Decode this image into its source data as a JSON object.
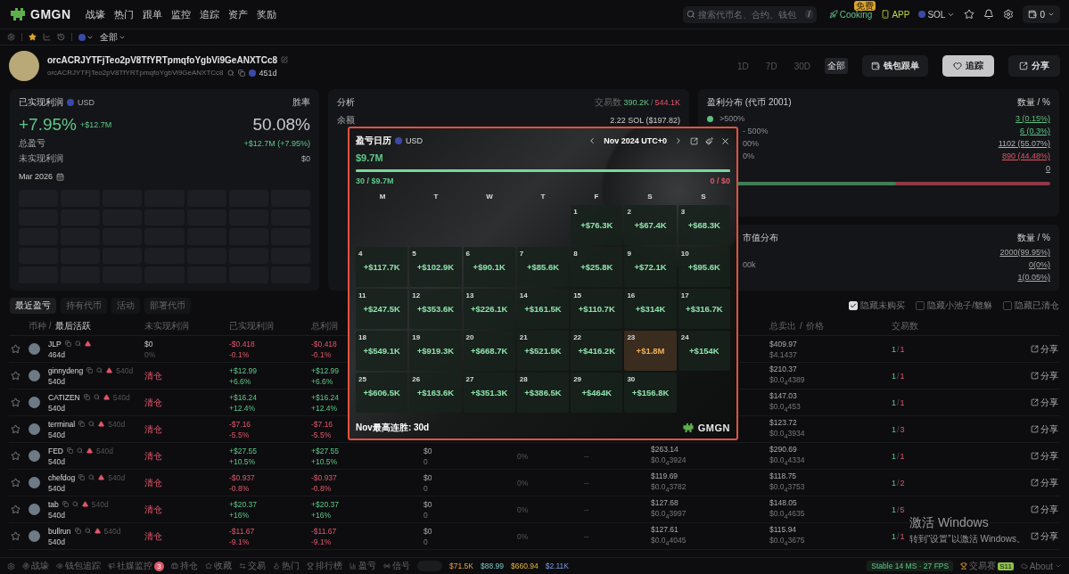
{
  "nav": {
    "logo": "GMGN",
    "items": [
      "战壕",
      "热门",
      "跟单",
      "监控",
      "追踪",
      "资产",
      "奖励"
    ],
    "search": {
      "placeholder": "搜索代币名、合约、钱包",
      "shortcut": "/"
    },
    "cooking": {
      "label": "Cooking",
      "badge": "免费"
    },
    "app": "APP",
    "chain": "SOL",
    "wallet_count": "0"
  },
  "subbar": {
    "filter": "全部"
  },
  "profile": {
    "name": "orcACRJYTFjTeo2pV8TfYRTpmqfoYgbVi9GeANXTCc8",
    "address": "orcACRJYTFjTeo2pV8TfYRTpmqfoYgbVi9GeANXTCc8",
    "age": "451d",
    "periods": [
      {
        "label": "1D",
        "selected": false
      },
      {
        "label": "7D",
        "selected": false
      },
      {
        "label": "30D",
        "selected": false
      },
      {
        "label": "全部",
        "selected": true
      }
    ],
    "buttons": [
      {
        "kind": "copytrade",
        "label": "钱包跟单"
      },
      {
        "kind": "follow",
        "label": "追踪"
      },
      {
        "kind": "share",
        "label": "分享"
      }
    ]
  },
  "pnl_panel": {
    "title": "已实现利润",
    "currency": "USD",
    "winrate_label": "胜率",
    "pct": "+7.95%",
    "amount": "+$12.7M",
    "winrate": "50.08%",
    "rows": [
      {
        "label": "总盈亏",
        "value": "+$12.7M (+7.95%)",
        "kind": "gain"
      },
      {
        "label": "未实现利润",
        "value": "$0",
        "kind": "neutral"
      }
    ],
    "month": "Mar 2026"
  },
  "analysis_panel": {
    "title": "分析",
    "trades_label": "交易数",
    "trades_buy": "390.2K",
    "trades_sep": "/",
    "trades_sell": "544.1K",
    "rows": [
      {
        "label": "余额",
        "value": "2.22 SOL ($197.82)"
      }
    ]
  },
  "profit_dist": {
    "title": "盈利分布 (代币 2001)",
    "header": "数量 / %",
    "rows": [
      {
        "label": ">500%",
        "value": "3 (0.15%)",
        "color": "#5fbf7f"
      },
      {
        "label": "- 500%",
        "value": "6 (0.3%)",
        "kind": "gain"
      },
      {
        "label": "00%",
        "value": "1102 (55.07%)",
        "kind": "neutral"
      },
      {
        "label": "0%",
        "value": "890 (44.48%)",
        "kind": "loss"
      },
      {
        "value": "0",
        "kind": "neutral"
      }
    ],
    "level": 0.55
  },
  "mcap_dist": {
    "title": "市值分布",
    "header": "数量 / %",
    "rows": [
      {
        "value": "2000(99.95%)"
      },
      {
        "label": "00k",
        "value": "0(0%)"
      },
      {
        "value": "1(0.05%)"
      }
    ]
  },
  "tabs": [
    {
      "label": "最近盈亏",
      "selected": true
    },
    {
      "label": "持有代币",
      "selected": false
    },
    {
      "label": "活动",
      "selected": false
    },
    {
      "label": "部署代币",
      "selected": false
    }
  ],
  "filters": [
    {
      "label": "隐藏未购买",
      "checked": true
    },
    {
      "label": "隐藏小池子/貔貅",
      "checked": false
    },
    {
      "label": "隐藏已清仓",
      "checked": false
    }
  ],
  "table": {
    "columns": {
      "token_prefix": "币种 /",
      "token": "最后活跃",
      "unrealized": "未实现利润",
      "realized": "已实现利润",
      "total": "总利润",
      "sold": "总卖出",
      "sep": "/",
      "price": "价格",
      "trades": "交易数"
    },
    "rows": [
      {
        "token": "JLP",
        "age": "464d",
        "unrealized": {
          "kind": "amount",
          "value": "$0",
          "pct": "0%"
        },
        "realized": {
          "value": "-$0.418",
          "pct": "-0.1%",
          "kind": "loss"
        },
        "total": {
          "value": "-$0.418",
          "pct": "-0.1%",
          "kind": "loss"
        },
        "sold": [
          "$409.97",
          "$4.1437"
        ],
        "wins": "1",
        "sep": "/",
        "trades": "1",
        "share": "分享"
      },
      {
        "token": "ginnydeng",
        "tag": "540d",
        "age": "540d",
        "unrealized": {
          "kind": "closed",
          "label": "清仓"
        },
        "realized": {
          "value": "+$12.99",
          "pct": "+6.6%",
          "kind": "gain"
        },
        "total": {
          "value": "+$12.99",
          "pct": "+6.6%",
          "kind": "gain"
        },
        "sold": [
          "$210.37",
          "$0.0$_{4}$4389"
        ],
        "wins": "1",
        "sep": "/",
        "trades": "1",
        "share": "分享"
      },
      {
        "token": "CATIZEN",
        "tag": "540d",
        "age": "540d",
        "unrealized": {
          "kind": "closed",
          "label": "清仓"
        },
        "realized": {
          "value": "+$16.24",
          "pct": "+12.4%",
          "kind": "gain"
        },
        "total": {
          "value": "+$16.24",
          "pct": "+12.4%",
          "kind": "gain"
        },
        "sold": [
          "$147.03",
          "$0.0$_{4}$453"
        ],
        "wins": "1",
        "sep": "/",
        "trades": "1",
        "share": "分享"
      },
      {
        "token": "terminal",
        "tag": "540d",
        "age": "540d",
        "unrealized": {
          "kind": "closed",
          "label": "清仓"
        },
        "realized": {
          "value": "-$7.16",
          "pct": "-5.5%",
          "kind": "loss"
        },
        "total": {
          "value": "-$7.16",
          "pct": "-5.5%",
          "kind": "loss"
        },
        "sold": [
          "$123.72",
          "$0.0$_{4}$3934"
        ],
        "wins": "1",
        "sep": "/",
        "trades": "3",
        "share": "分享"
      },
      {
        "token": "FED",
        "tag": "540d",
        "age": "540d",
        "unrealized": {
          "kind": "closed",
          "label": "清仓"
        },
        "realized": {
          "value": "+$27.55",
          "pct": "+10.5%",
          "kind": "gain"
        },
        "total": {
          "value": "+$27.55",
          "pct": "+10.5%",
          "kind": "gain"
        },
        "col5": [
          "$0",
          "0"
        ],
        "col6": "0%",
        "col7": "--",
        "bought": [
          "$263.14",
          "$0.0$_{4}$3924"
        ],
        "sold": [
          "$290.69",
          "$0.0$_{4}$4334"
        ],
        "wins": "1",
        "sep": "/",
        "trades": "1",
        "share": "分享"
      },
      {
        "token": "chefdog",
        "tag": "540d",
        "age": "540d",
        "unrealized": {
          "kind": "closed",
          "label": "清仓"
        },
        "realized": {
          "value": "-$0.937",
          "pct": "-0.8%",
          "kind": "loss"
        },
        "total": {
          "value": "-$0.937",
          "pct": "-0.8%",
          "kind": "loss"
        },
        "col5": [
          "$0",
          "0"
        ],
        "col6": "0%",
        "col7": "--",
        "bought": [
          "$119.69",
          "$0.0$_{4}$3782"
        ],
        "sold": [
          "$118.75",
          "$0.0$_{4}$3753"
        ],
        "wins": "1",
        "sep": "/",
        "trades": "2",
        "share": "分享"
      },
      {
        "token": "tab",
        "tag": "540d",
        "age": "540d",
        "unrealized": {
          "kind": "closed",
          "label": "清仓"
        },
        "realized": {
          "value": "+$20.37",
          "pct": "+16%",
          "kind": "gain"
        },
        "total": {
          "value": "+$20.37",
          "pct": "+16%",
          "kind": "gain"
        },
        "col5": [
          "$0",
          "0"
        ],
        "col6": "0%",
        "col7": "--",
        "bought": [
          "$127.68",
          "$0.0$_{4}$3997"
        ],
        "sold": [
          "$148.05",
          "$0.0$_{4}$4635"
        ],
        "wins": "1",
        "sep": "/",
        "trades": "5",
        "share": "分享"
      },
      {
        "token": "bullrun",
        "tag": "540d",
        "age": "540d",
        "unrealized": {
          "kind": "closed",
          "label": "清仓"
        },
        "realized": {
          "value": "-$11.67",
          "pct": "-9.1%",
          "kind": "loss"
        },
        "total": {
          "value": "-$11.67",
          "pct": "-9.1%",
          "kind": "loss"
        },
        "col5": [
          "$0",
          "0"
        ],
        "col6": "0%",
        "col7": "--",
        "bought": [
          "$127.61",
          "$0.0$_{4}$4045"
        ],
        "sold": [
          "$115.94",
          "$0.0$_{4}$3675"
        ],
        "wins": "1",
        "sep": "/",
        "trades": "1",
        "share": "分享"
      }
    ]
  },
  "calendar": {
    "title": "盈亏日历",
    "currency": "USD",
    "month": "Nov 2024 UTC+0",
    "total": "$9.7M",
    "level": 1,
    "wins": "30 / $9.7M",
    "losses": "0 / $0",
    "weekdays": [
      "M",
      "T",
      "W",
      "T",
      "F",
      "S",
      "S"
    ],
    "days": [
      {
        "kind": "blank"
      },
      {
        "kind": "blank"
      },
      {
        "kind": "blank"
      },
      {
        "kind": "blank"
      },
      {
        "kind": "day",
        "day": "1",
        "value": "+$76.3K",
        "highlighted": false
      },
      {
        "kind": "day",
        "day": "2",
        "value": "+$67.4K",
        "highlighted": false
      },
      {
        "kind": "day",
        "day": "3",
        "value": "+$68.3K",
        "highlighted": false
      },
      {
        "kind": "day",
        "day": "4",
        "value": "+$117.7K",
        "highlighted": false
      },
      {
        "kind": "day",
        "day": "5",
        "value": "+$102.9K",
        "highlighted": false
      },
      {
        "kind": "day",
        "day": "6",
        "value": "+$90.1K",
        "highlighted": false
      },
      {
        "kind": "day",
        "day": "7",
        "value": "+$85.6K",
        "highlighted": false
      },
      {
        "kind": "day",
        "day": "8",
        "value": "+$25.8K",
        "highlighted": false
      },
      {
        "kind": "day",
        "day": "9",
        "value": "+$72.1K",
        "highlighted": false
      },
      {
        "kind": "day",
        "day": "10",
        "value": "+$95.6K",
        "highlighted": false
      },
      {
        "kind": "day",
        "day": "11",
        "value": "+$247.5K",
        "highlighted": false
      },
      {
        "kind": "day",
        "day": "12",
        "value": "+$353.6K",
        "highlighted": false
      },
      {
        "kind": "day",
        "day": "13",
        "value": "+$226.1K",
        "highlighted": false
      },
      {
        "kind": "day",
        "day": "14",
        "value": "+$161.5K",
        "highlighted": false
      },
      {
        "kind": "day",
        "day": "15",
        "value": "+$110.7K",
        "highlighted": false
      },
      {
        "kind": "day",
        "day": "16",
        "value": "+$314K",
        "highlighted": false
      },
      {
        "kind": "day",
        "day": "17",
        "value": "+$316.7K",
        "highlighted": false
      },
      {
        "kind": "day",
        "day": "18",
        "value": "+$549.1K",
        "highlighted": false
      },
      {
        "kind": "day",
        "day": "19",
        "value": "+$919.3K",
        "highlighted": false
      },
      {
        "kind": "day",
        "day": "20",
        "value": "+$668.7K",
        "highlighted": false
      },
      {
        "kind": "day",
        "day": "21",
        "value": "+$521.5K",
        "highlighted": false
      },
      {
        "kind": "day",
        "day": "22",
        "value": "+$416.2K",
        "highlighted": false
      },
      {
        "kind": "day",
        "day": "23",
        "value": "+$1.8M",
        "highlighted": true
      },
      {
        "kind": "day",
        "day": "24",
        "value": "+$154K",
        "highlighted": false
      },
      {
        "kind": "day",
        "day": "25",
        "value": "+$606.5K",
        "highlighted": false
      },
      {
        "kind": "day",
        "day": "26",
        "value": "+$163.6K",
        "highlighted": false
      },
      {
        "kind": "day",
        "day": "27",
        "value": "+$351.3K",
        "highlighted": false
      },
      {
        "kind": "day",
        "day": "28",
        "value": "+$386.5K",
        "highlighted": false
      },
      {
        "kind": "day",
        "day": "29",
        "value": "+$464K",
        "highlighted": false
      },
      {
        "kind": "day",
        "day": "30",
        "value": "+$156.8K",
        "highlighted": false
      }
    ],
    "streak": "Nov最高连胜: 30d",
    "brand": "GMGN"
  },
  "bottom_bar": {
    "items": [
      {
        "label": "战壕"
      },
      {
        "label": "钱包追踪"
      },
      {
        "label": "社媒监控",
        "badge": "3"
      },
      {
        "label": "持仓"
      },
      {
        "label": "收藏"
      },
      {
        "label": "交易"
      },
      {
        "label": "热门"
      },
      {
        "label": "排行榜"
      },
      {
        "label": "盈亏"
      },
      {
        "label": "信号"
      }
    ],
    "prices": [
      "$71.5K",
      "$88.99",
      "$660.94",
      "$2.11K"
    ],
    "status": "Stable 14 MS · 27 FPS",
    "contest": "交易赛",
    "contest_badge": "S11",
    "about": "About"
  },
  "os_notice": {
    "title": "激活 Windows",
    "text": "转到“设置”以激活 Windows。"
  }
}
